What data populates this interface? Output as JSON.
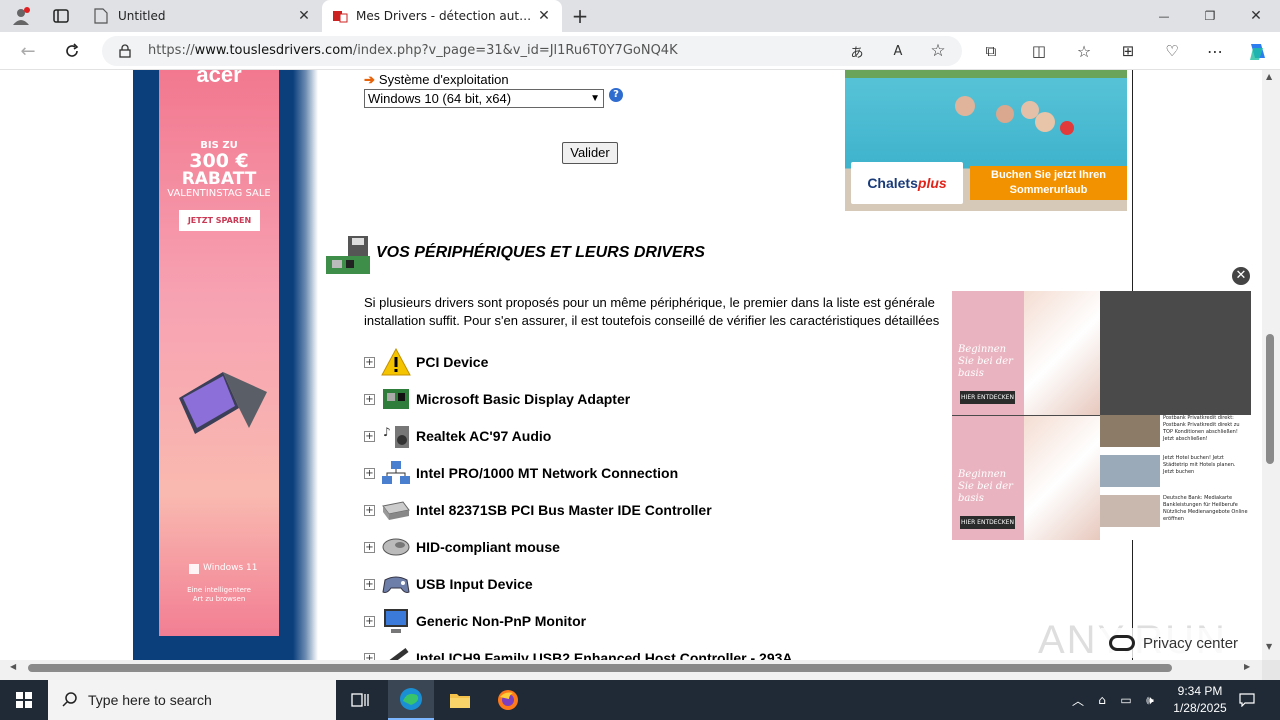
{
  "browser": {
    "tabs": [
      {
        "label": "Untitled",
        "close": "✕"
      },
      {
        "label": "Mes Drivers - détection automatique",
        "close": "✕"
      }
    ],
    "new_tab": "+",
    "url_prefix": "https://",
    "url_domain": "www.touslesdrivers.com",
    "url_path": "/index.php?v_page=31&v_id=Jl1Ru6T0Y7GoNQ4K",
    "window_controls": {
      "minimize": "—",
      "maximize": "❐",
      "close": "✕"
    }
  },
  "page": {
    "os_label": "Système d'exploitation",
    "os_arrow": "➔",
    "os_selected": "Windows 10 (64 bit, x64)",
    "help": "?",
    "submit_label": "Valider",
    "section_title": "VOS PÉRIPHÉRIQUES ET LEURS DRIVERS",
    "intro_line1": "Si plusieurs drivers sont proposés pour un même périphérique, le premier dans la liste est générale",
    "intro_line2": "installation suffit. Pour s'en assurer, il est toutefois conseillé de vérifier les caractéristiques détaillées",
    "devices": [
      {
        "name": "PCI Device",
        "icon": "warning-icon"
      },
      {
        "name": "Microsoft Basic Display Adapter",
        "icon": "display-card-icon"
      },
      {
        "name": "Realtek AC'97 Audio",
        "icon": "speaker-icon"
      },
      {
        "name": "Intel PRO/1000 MT Network Connection",
        "icon": "network-icon"
      },
      {
        "name": "Intel 82371SB PCI Bus Master IDE Controller",
        "icon": "drive-icon"
      },
      {
        "name": "HID-compliant mouse",
        "icon": "mouse-icon"
      },
      {
        "name": "USB Input Device",
        "icon": "gamepad-icon"
      },
      {
        "name": "Generic Non-PnP Monitor",
        "icon": "monitor-icon"
      },
      {
        "name": "Intel ICH9 Family USB2 Enhanced Host Controller - 293A",
        "icon": "usb-icon"
      }
    ],
    "expand_symbol": "+"
  },
  "ads": {
    "left_banner": {
      "brand": "acer",
      "line1": "BIS ZU",
      "line2": "300 €",
      "line3": "RABATT",
      "line4": "VALENTINSTAG SALE",
      "cta": "JETZT SPAREN",
      "os": "Windows 11",
      "tagline": "Eine intelligentere Art zu browsen"
    },
    "chalets": {
      "logo_text": "Chalets",
      "logo_accent": "plus",
      "cta": "Buchen Sie jetzt Ihren Sommerurlaub"
    },
    "popup": {
      "close": "✕",
      "cells": [
        {
          "text": "Beginnen Sie bei der basis",
          "button": "HIER ENTDECKEN"
        },
        {
          "text": "Beginnen Sie bei der basis",
          "button": "HIER ENTDECKEN"
        }
      ],
      "news": [
        "Postbank Privatkredit direkt: Postbank Privatkredit direkt zu TOP Konditionen abschließen! Jetzt abschließen!",
        "Jetzt Hotel buchen! Jetzt Städtetrip mit Hotels planen. Jetzt buchen",
        "Deutsche Bank: Mediakarte Bankleistungen für Heilberufe Nützliche Medienangebote Online eröffnen"
      ]
    }
  },
  "privacy_center": "Privacy center",
  "watermark": "ANY.RUN",
  "taskbar": {
    "search_placeholder": "Type here to search",
    "time": "9:34 PM",
    "date": "1/28/2025"
  },
  "colors": {
    "accent_orange": "#e8620a",
    "chalets_cta": "#f39200",
    "taskbar": "#1f2a36"
  }
}
